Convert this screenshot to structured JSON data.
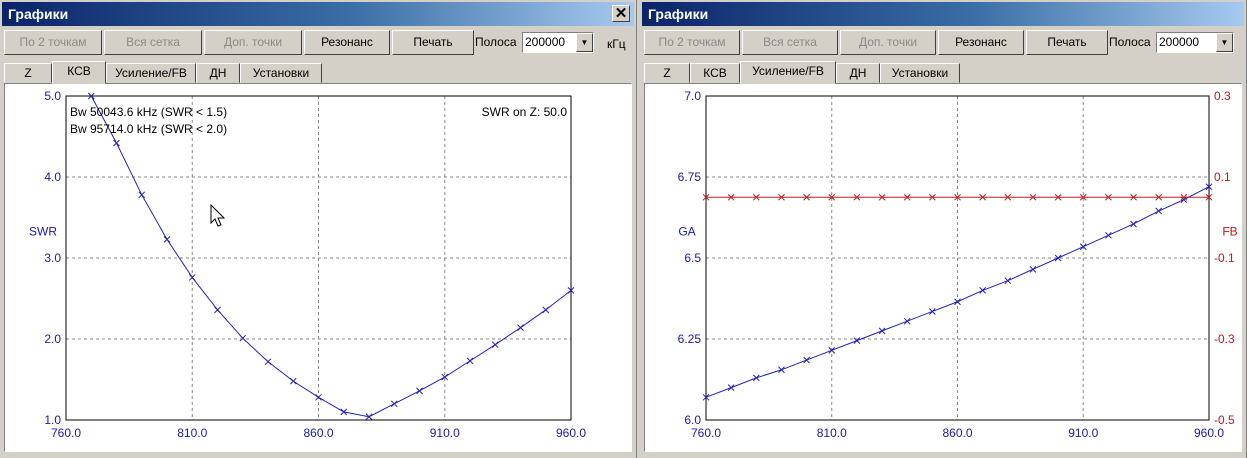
{
  "left": {
    "title": "Графики",
    "close": "✕",
    "toolbar": {
      "btn1": "По 2 точкам",
      "btn2": "Вся сетка",
      "btn3": "Доп. точки",
      "btn4": "Резонанс",
      "btn5": "Печать",
      "band_label": "Полоса",
      "band_value": "200000",
      "unit": "кГц"
    },
    "tabs": [
      "Z",
      "КСВ",
      "Усиление/FB",
      "ДН",
      "Установки"
    ],
    "active_tab": "КСВ"
  },
  "right": {
    "title": "Графики",
    "toolbar": {
      "btn1": "По 2 точкам",
      "btn2": "Вся сетка",
      "btn3": "Доп. точки",
      "btn4": "Резонанс",
      "btn5": "Печать",
      "band_label": "Полоса",
      "band_value": "200000"
    },
    "tabs": [
      "Z",
      "КСВ",
      "Усиление/FB",
      "ДН",
      "Установки"
    ],
    "active_tab": "Усиление/FB"
  },
  "chart_data": [
    {
      "type": "line",
      "ylabel": "SWR",
      "annotations": [
        "Bw 50043.6 kHz (SWR < 1.5)",
        "Bw 95714.0 kHz (SWR < 2.0)",
        "SWR on Z: 50.0"
      ],
      "xlim": [
        760,
        960
      ],
      "ylim": [
        1.0,
        5.0
      ],
      "x_ticks": [
        "760.0",
        "810.0",
        "860.0",
        "910.0",
        "960.0"
      ],
      "y_ticks": [
        "5.0",
        "4.0",
        "3.0",
        "2.0",
        "1.0"
      ],
      "grid": true,
      "series": [
        {
          "color": "#2020c0",
          "x": [
            770,
            780,
            790,
            800,
            810,
            820,
            830,
            840,
            850,
            860,
            870,
            880,
            890,
            900,
            910,
            920,
            930,
            940,
            950,
            960
          ],
          "y": [
            5.0,
            4.42,
            3.78,
            3.23,
            2.76,
            2.36,
            2.01,
            1.72,
            1.48,
            1.28,
            1.1,
            1.04,
            1.2,
            1.36,
            1.53,
            1.73,
            1.93,
            2.14,
            2.36,
            2.6
          ]
        }
      ]
    },
    {
      "type": "line",
      "ylabel": "GA",
      "y2label": "FB",
      "xlim": [
        760,
        960
      ],
      "ylim": [
        6.0,
        7.0
      ],
      "y2lim": [
        -0.5,
        0.3
      ],
      "x_ticks": [
        "760.0",
        "810.0",
        "860.0",
        "910.0",
        "960.0"
      ],
      "y_ticks": [
        "7.0",
        "6.75",
        "6.5",
        "6.25",
        "6.0"
      ],
      "y2_ticks": [
        "0.3",
        "0.1",
        "-0.1",
        "-0.3",
        "-0.5"
      ],
      "grid": true,
      "series": [
        {
          "color": "#2020c0",
          "axis": "left",
          "x": [
            760,
            770,
            780,
            790,
            800,
            810,
            820,
            830,
            840,
            850,
            860,
            870,
            880,
            890,
            900,
            910,
            920,
            930,
            940,
            950,
            960
          ],
          "y": [
            6.07,
            6.1,
            6.13,
            6.155,
            6.185,
            6.215,
            6.245,
            6.275,
            6.305,
            6.335,
            6.365,
            6.4,
            6.43,
            6.465,
            6.5,
            6.535,
            6.57,
            6.605,
            6.645,
            6.68,
            6.72
          ]
        },
        {
          "color": "#c02020",
          "axis": "right",
          "x": [
            760,
            770,
            780,
            790,
            800,
            810,
            820,
            830,
            840,
            850,
            860,
            870,
            880,
            890,
            900,
            910,
            920,
            930,
            940,
            950,
            960
          ],
          "y": [
            0.05,
            0.05,
            0.05,
            0.05,
            0.05,
            0.05,
            0.05,
            0.05,
            0.05,
            0.05,
            0.05,
            0.05,
            0.05,
            0.05,
            0.05,
            0.05,
            0.05,
            0.05,
            0.05,
            0.05,
            0.05
          ]
        }
      ]
    }
  ]
}
